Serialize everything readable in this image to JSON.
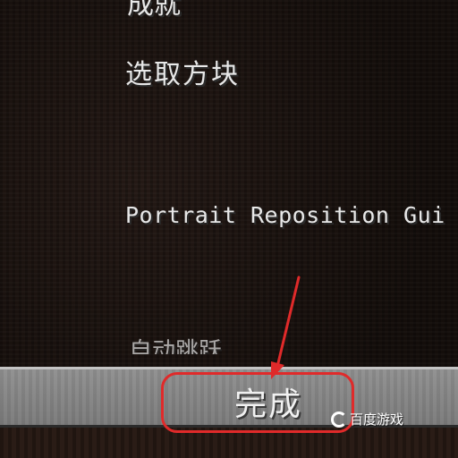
{
  "menu": {
    "cut_top_label": "成就",
    "select_block_label": "选取方块",
    "portrait_label": "Portrait Reposition Gui",
    "cut_bottom_label": "自动跳跃"
  },
  "footer": {
    "done_label": "完成"
  },
  "watermark": {
    "text": "百度游戏",
    "logo_icon": "baidu-games-logo-icon"
  },
  "annotations": {
    "highlight_color": "#e02a2a",
    "arrow_color": "#e02a2a"
  }
}
